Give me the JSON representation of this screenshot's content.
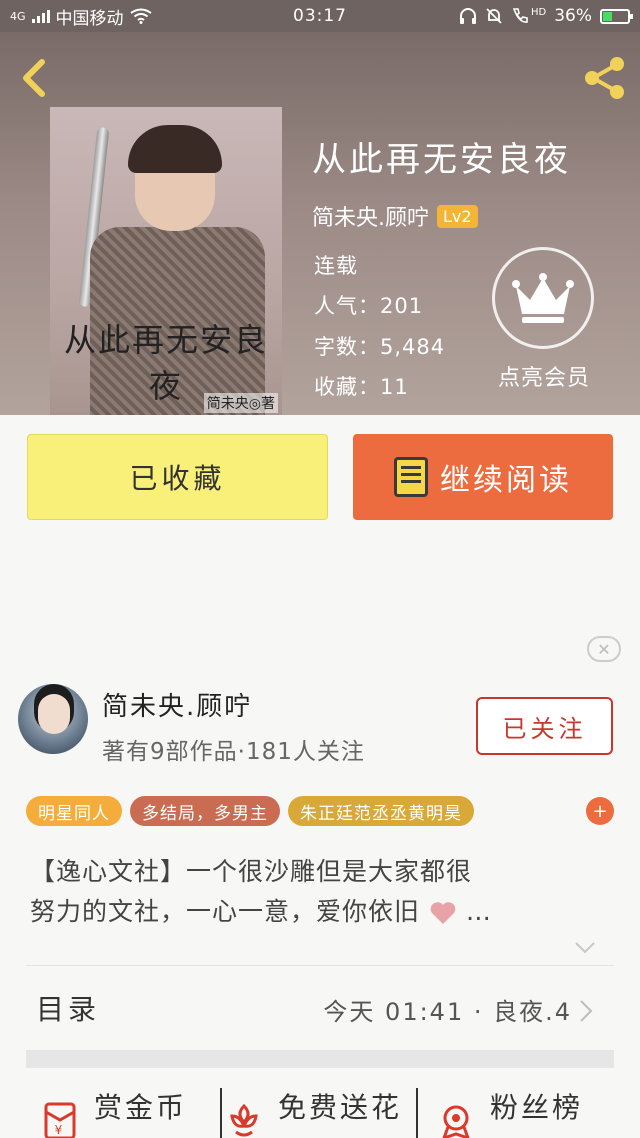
{
  "status_bar": {
    "network": "4G",
    "carrier": "中国移动",
    "time": "03:17",
    "hd": "HD",
    "battery": "36%",
    "battery_level": 0.36
  },
  "book": {
    "title": "从此再无安良夜",
    "author": "简未央.顾咛",
    "level": "Lv2",
    "status": "连载",
    "popularity": "人气：201",
    "word_count": "字数：5,484",
    "favorites": "收藏：11",
    "cover_title": "从此再无安良夜",
    "cover_author": "简未央◎著"
  },
  "vip": {
    "label": "点亮会员"
  },
  "actions": {
    "collect_label": "已收藏",
    "read_label": "继续阅读"
  },
  "author_card": {
    "name": "简未央.顾咛",
    "meta": "著有9部作品·181人关注",
    "follow_label": "已关注"
  },
  "tags": [
    {
      "label": "明星同人",
      "color": "#f4ad3b"
    },
    {
      "label": "多结局，多男主",
      "color": "#c96c52"
    },
    {
      "label": "朱正廷范丞丞黄明昊",
      "color": "#d8a838"
    }
  ],
  "tag_more": "+",
  "description": {
    "line1": "【逸心文社】一个很沙雕但是大家都很",
    "line2": "努力的文社，一心一意，爱你依旧",
    "ellipsis": "…"
  },
  "catalog": {
    "label": "目录",
    "latest": "今天 01:41 · 良夜.4"
  },
  "bottom_tabs": [
    {
      "label": "赏金币",
      "icon": "red-envelope-icon"
    },
    {
      "label": "免费送花",
      "icon": "flower-icon"
    },
    {
      "label": "粉丝榜",
      "icon": "ranking-icon"
    }
  ],
  "colors": {
    "collect_bg": "#f9f07a",
    "read_bg": "#ec6c3f",
    "follow": "#c9362b",
    "level_badge": "#f4b537"
  }
}
